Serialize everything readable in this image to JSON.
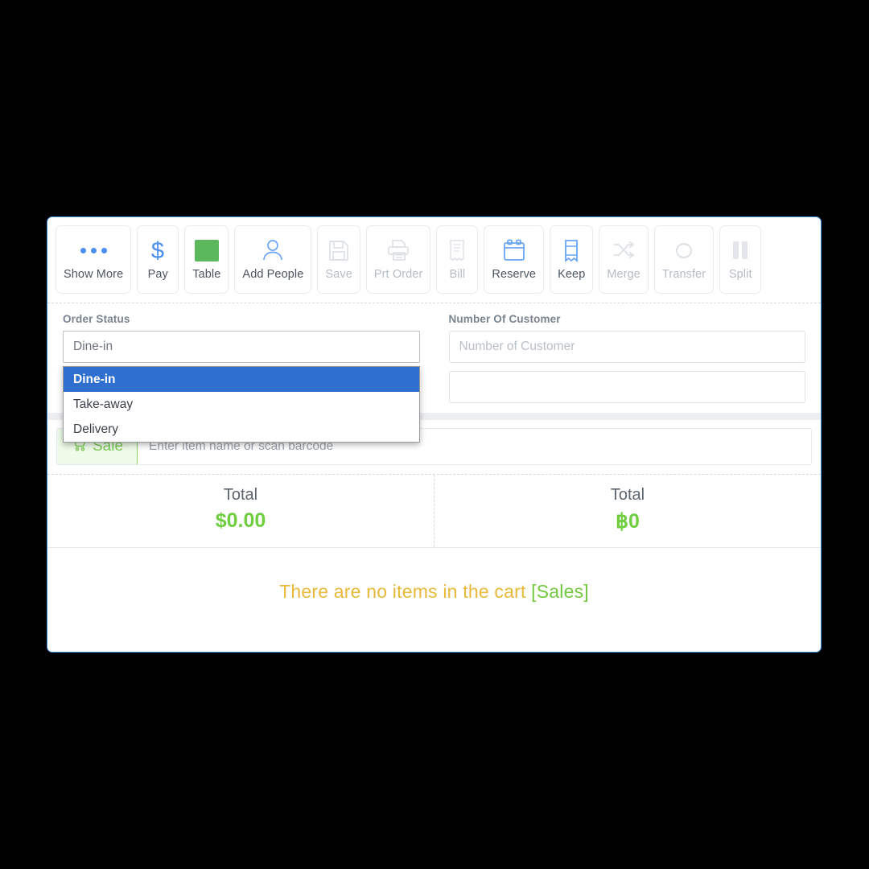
{
  "toolbar": {
    "buttons": [
      {
        "label": "Show More",
        "icon": "more-dots-icon",
        "enabled": true
      },
      {
        "label": "Pay",
        "icon": "dollar-icon",
        "enabled": true
      },
      {
        "label": "Table",
        "icon": "table-icon",
        "enabled": true
      },
      {
        "label": "Add People",
        "icon": "person-add-icon",
        "enabled": true
      },
      {
        "label": "Save",
        "icon": "floppy-save-icon",
        "enabled": false
      },
      {
        "label": "Prt Order",
        "icon": "printer-icon",
        "enabled": false
      },
      {
        "label": "Bill",
        "icon": "receipt-icon",
        "enabled": false
      },
      {
        "label": "Reserve",
        "icon": "calendar-icon",
        "enabled": true
      },
      {
        "label": "Keep",
        "icon": "bookmark-icon",
        "enabled": true
      },
      {
        "label": "Merge",
        "icon": "shuffle-icon",
        "enabled": false
      },
      {
        "label": "Transfer",
        "icon": "loop-arrows-icon",
        "enabled": false
      },
      {
        "label": "Split",
        "icon": "pause-bars-icon",
        "enabled": false
      }
    ]
  },
  "form": {
    "order_status": {
      "label": "Order Status",
      "value": "Dine-in",
      "expanded": true,
      "options": [
        "Dine-in",
        "Take-away",
        "Delivery"
      ],
      "selected_index": 0
    },
    "number_of_customer": {
      "label": "Number Of Customer",
      "value": "",
      "placeholder": "Number of Customer"
    },
    "row2_left": {
      "value": "",
      "placeholder": ""
    },
    "row2_right": {
      "value": "",
      "placeholder": ""
    }
  },
  "sale": {
    "button_label": "Sale",
    "button_icon": "shopping-cart-icon",
    "search_value": "",
    "search_placeholder": "Enter item name or scan barcode"
  },
  "totals": [
    {
      "caption": "Total",
      "value": "$0.00"
    },
    {
      "caption": "Total",
      "value": "฿0"
    }
  ],
  "cart": {
    "empty_message": "There are no items in the cart",
    "empty_tag": "[Sales]"
  },
  "colors": {
    "card_border": "#3e8ede",
    "accent_blue": "#4a8ef0",
    "dropdown_highlight": "#2f6fd0",
    "green": "#6ece3f",
    "table_green": "#5cb85c",
    "amber": "#e8b93a",
    "disabled_grey": "#b6bcc4"
  }
}
